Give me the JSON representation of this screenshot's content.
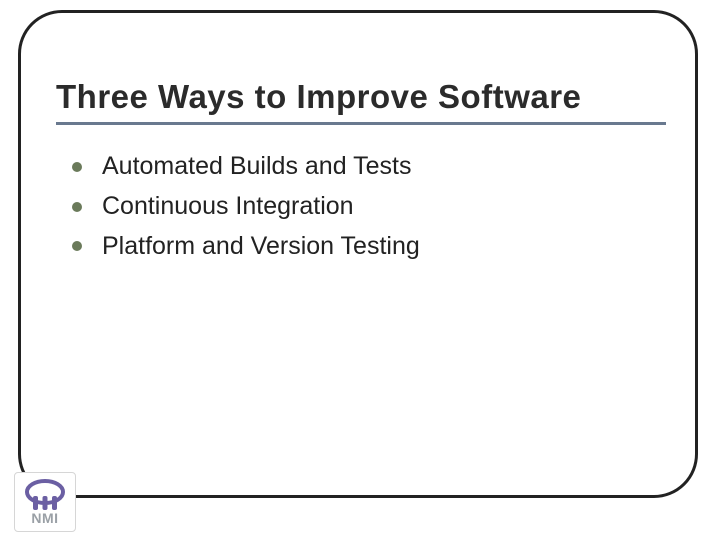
{
  "title": "Three Ways to Improve Software",
  "bullets": [
    "Automated Builds and Tests",
    "Continuous Integration",
    "Platform and Version Testing"
  ],
  "logo": {
    "label": "NMI"
  },
  "colors": {
    "underline": "#69798f",
    "bullet": "#6a7a5a",
    "border": "#222222",
    "logo_ring": "#6b5fa3",
    "logo_text": "#9aa0a6"
  }
}
